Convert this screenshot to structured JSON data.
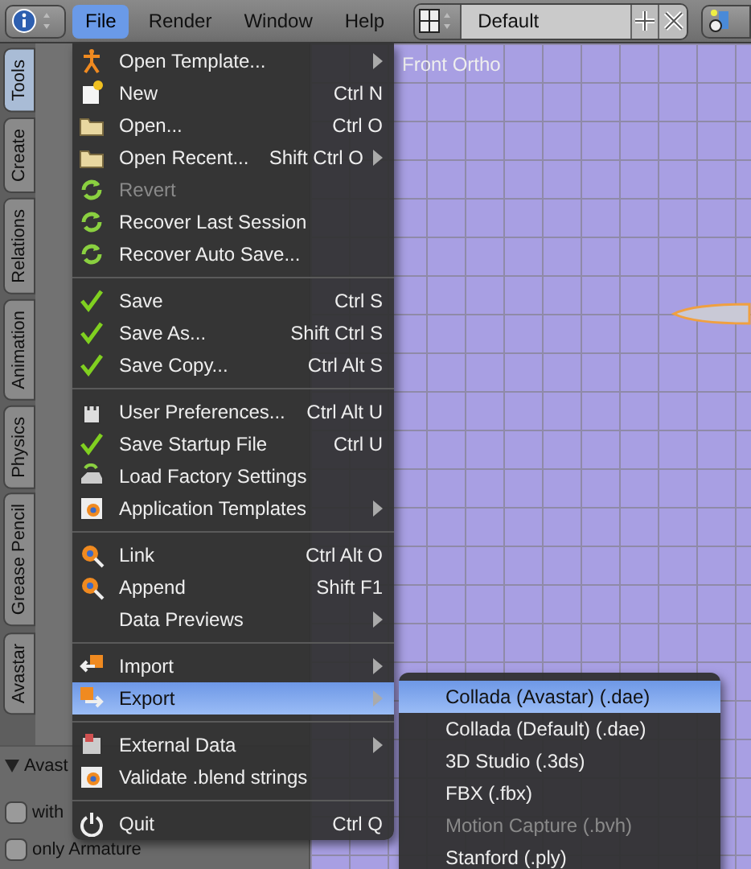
{
  "header": {
    "menus": [
      {
        "label": "File",
        "selected": true
      },
      {
        "label": "Render",
        "selected": false
      },
      {
        "label": "Window",
        "selected": false
      },
      {
        "label": "Help",
        "selected": false
      }
    ],
    "layout": {
      "value": "Default"
    }
  },
  "sidebar": {
    "tabs": [
      {
        "label": "Tools",
        "selected": true
      },
      {
        "label": "Create",
        "selected": false
      },
      {
        "label": "Relations",
        "selected": false
      },
      {
        "label": "Animation",
        "selected": false
      },
      {
        "label": "Physics",
        "selected": false
      },
      {
        "label": "Grease Pencil",
        "selected": false
      },
      {
        "label": "Avastar",
        "selected": false
      }
    ],
    "panel": {
      "title": "Avast",
      "options": [
        {
          "label": "with",
          "checked": false
        },
        {
          "label": "only Armature",
          "checked": false
        }
      ]
    }
  },
  "viewport": {
    "label": "Front Ortho"
  },
  "file_menu": {
    "sections": [
      {
        "items": [
          {
            "label": "Open Template...",
            "submenu": true,
            "disabled": false,
            "selected": false
          },
          {
            "label": "New",
            "shortcut": "Ctrl N",
            "submenu": false,
            "disabled": false,
            "selected": false
          },
          {
            "label": "Open...",
            "shortcut": "Ctrl O",
            "submenu": false,
            "disabled": false,
            "selected": false
          },
          {
            "label": "Open Recent...",
            "shortcut": "Shift Ctrl O",
            "submenu": true,
            "disabled": false,
            "selected": false
          },
          {
            "label": "Revert",
            "submenu": false,
            "disabled": true,
            "selected": false
          },
          {
            "label": "Recover Last Session",
            "submenu": false,
            "disabled": false,
            "selected": false
          },
          {
            "label": "Recover Auto Save...",
            "submenu": false,
            "disabled": false,
            "selected": false
          }
        ]
      },
      {
        "items": [
          {
            "label": "Save",
            "shortcut": "Ctrl S",
            "submenu": false,
            "disabled": false,
            "selected": false
          },
          {
            "label": "Save As...",
            "shortcut": "Shift Ctrl S",
            "submenu": false,
            "disabled": false,
            "selected": false
          },
          {
            "label": "Save Copy...",
            "shortcut": "Ctrl Alt S",
            "submenu": false,
            "disabled": false,
            "selected": false
          }
        ]
      },
      {
        "items": [
          {
            "label": "User Preferences...",
            "shortcut": "Ctrl Alt U",
            "submenu": false,
            "disabled": false,
            "selected": false
          },
          {
            "label": "Save Startup File",
            "shortcut": "Ctrl U",
            "submenu": false,
            "disabled": false,
            "selected": false
          },
          {
            "label": "Load Factory Settings",
            "submenu": false,
            "disabled": false,
            "selected": false
          },
          {
            "label": "Application Templates",
            "submenu": true,
            "disabled": false,
            "selected": false
          }
        ]
      },
      {
        "items": [
          {
            "label": "Link",
            "shortcut": "Ctrl Alt O",
            "submenu": false,
            "disabled": false,
            "selected": false
          },
          {
            "label": "Append",
            "shortcut": "Shift F1",
            "submenu": false,
            "disabled": false,
            "selected": false
          },
          {
            "label": "Data Previews",
            "submenu": true,
            "disabled": false,
            "selected": false
          }
        ]
      },
      {
        "items": [
          {
            "label": "Import",
            "submenu": true,
            "disabled": false,
            "selected": false
          },
          {
            "label": "Export",
            "submenu": true,
            "disabled": false,
            "selected": true
          }
        ]
      },
      {
        "items": [
          {
            "label": "External Data",
            "submenu": true,
            "disabled": false,
            "selected": false
          },
          {
            "label": "Validate .blend strings",
            "submenu": false,
            "disabled": false,
            "selected": false
          }
        ]
      },
      {
        "items": [
          {
            "label": "Quit",
            "shortcut": "Ctrl Q",
            "submenu": false,
            "disabled": false,
            "selected": false
          }
        ]
      }
    ]
  },
  "export_menu": {
    "items": [
      {
        "label": "Collada (Avastar) (.dae)",
        "disabled": false,
        "selected": true
      },
      {
        "label": "Collada (Default) (.dae)",
        "disabled": false,
        "selected": false
      },
      {
        "label": "3D Studio (.3ds)",
        "disabled": false,
        "selected": false
      },
      {
        "label": "FBX (.fbx)",
        "disabled": false,
        "selected": false
      },
      {
        "label": "Motion Capture (.bvh)",
        "disabled": true,
        "selected": false
      },
      {
        "label": "Stanford (.ply)",
        "disabled": false,
        "selected": false
      }
    ]
  }
}
